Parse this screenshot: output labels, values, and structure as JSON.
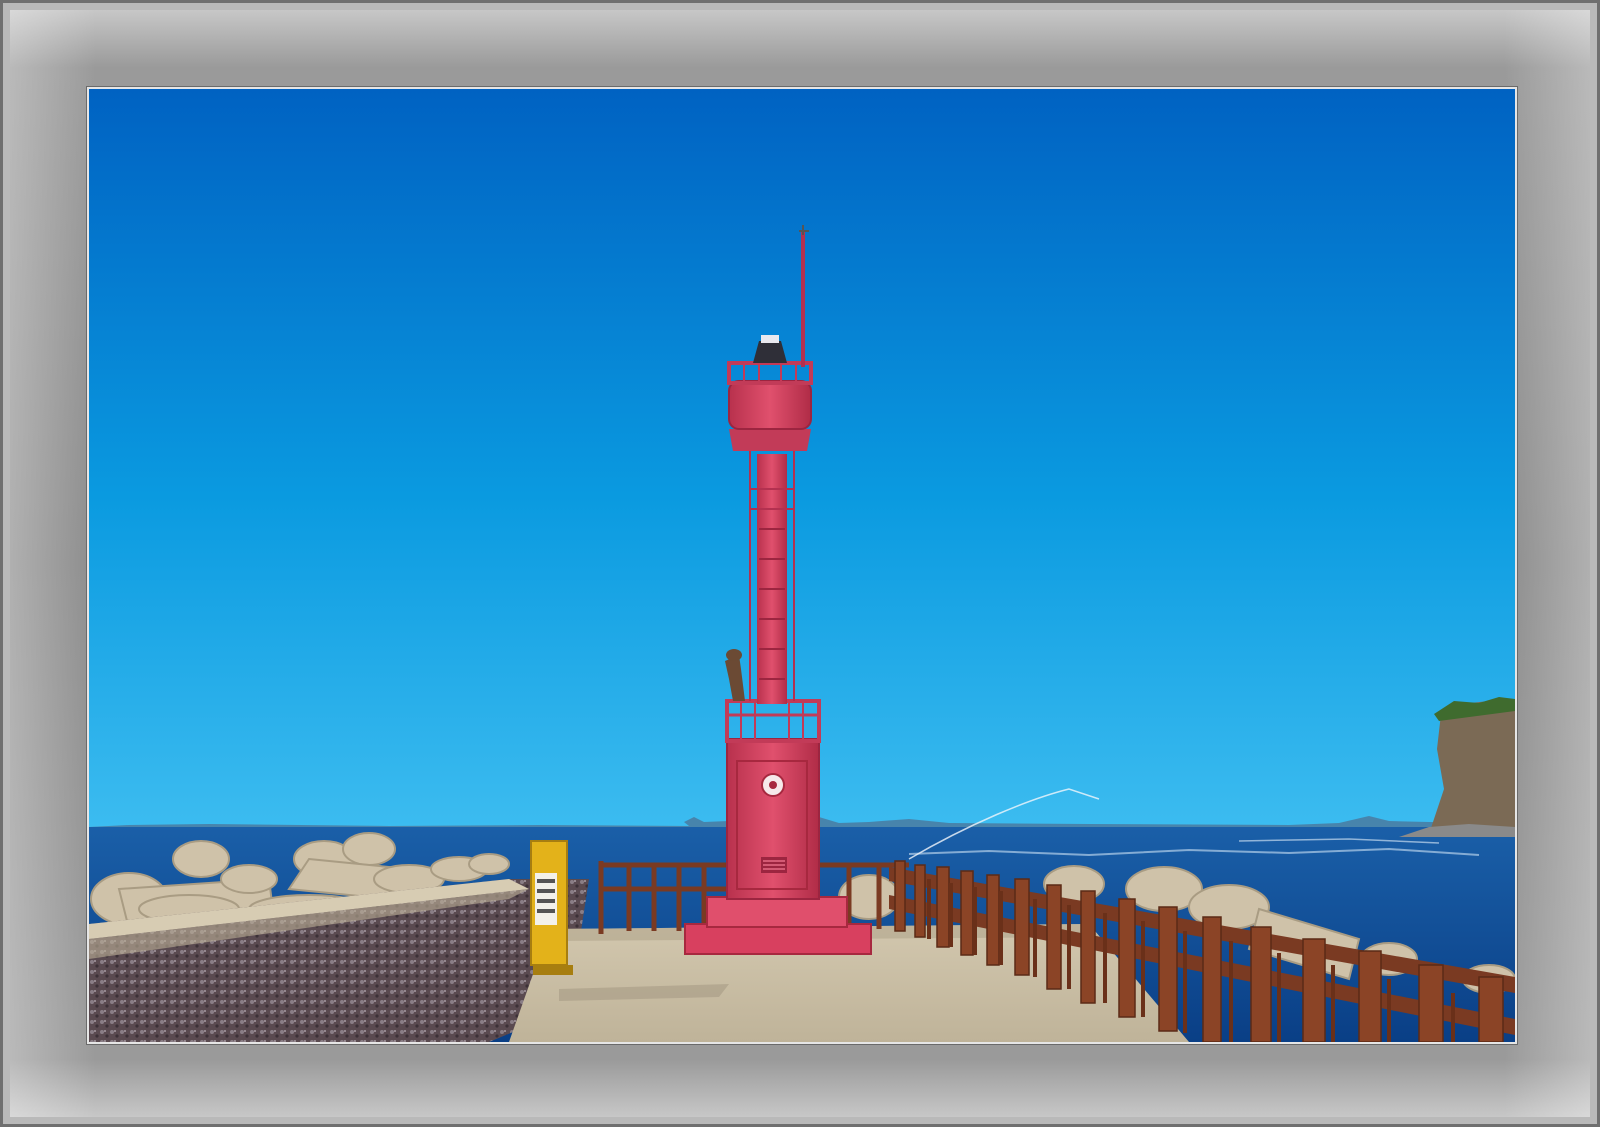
{
  "image": {
    "subject": "lighthouse-photo",
    "palette": {
      "sky_top": "#0062c2",
      "sky_bottom": "#2fb6ee",
      "sea": "#0d4f9c",
      "lighthouse": "#d8405f",
      "railing": "#7a3a22",
      "concrete": "#c9bfa8",
      "frame": "#8c8c8c"
    }
  }
}
